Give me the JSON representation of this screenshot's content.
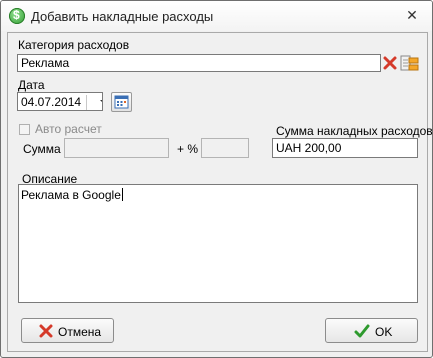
{
  "window": {
    "title": "Добавить накладные расходы"
  },
  "form": {
    "category_label": "Категория расходов",
    "category_value": "Реклама",
    "date_label": "Дата",
    "date_value": "04.07.2014",
    "auto_calc_label": "Авто расчет",
    "sum_label": "Сумма",
    "plus_percent_label": "+ %",
    "overhead_sum_label": "Сумма накладных расходов",
    "overhead_sum_value": "UAH 200,00",
    "description_label": "Описание",
    "description_value": "Реклама в Google"
  },
  "buttons": {
    "cancel_label": "Отмена",
    "ok_label": "OK"
  },
  "colors": {
    "ok_check": "#2e9a2e",
    "cancel_x": "#d53a2a"
  }
}
